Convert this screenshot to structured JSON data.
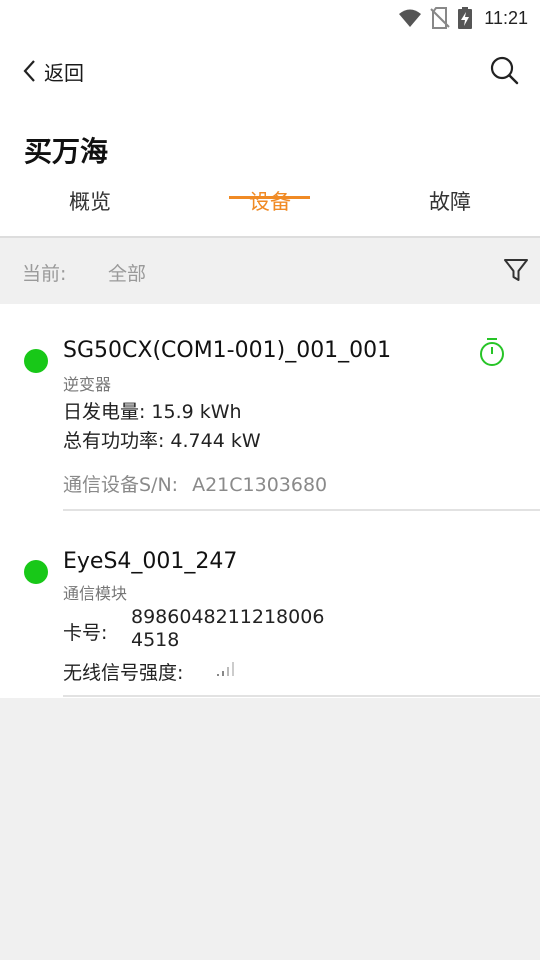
{
  "status_bar": {
    "time": "11:21"
  },
  "header": {
    "back_label": "返回",
    "title": "买万海"
  },
  "tabs": [
    {
      "label": "概览"
    },
    {
      "label": "设备"
    },
    {
      "label": "故障"
    }
  ],
  "filter": {
    "label": "当前:",
    "value": "全部"
  },
  "devices": [
    {
      "name": "SG50CX(COM1-001)_001_001",
      "type": "逆变器",
      "status_color": "#18c818",
      "daily_energy_label": "日发电量:",
      "daily_energy_value": "15.9 kWh",
      "active_power_label": "总有功功率:",
      "active_power_value": "4.744 kW",
      "comm_sn_label": "通信设备S/N:",
      "comm_sn_value": "A21C1303680"
    },
    {
      "name": "EyeS4_001_247",
      "type": "通信模块",
      "status_color": "#18c818",
      "card_label": "卡号:",
      "card_line1": "8986048211218006",
      "card_line2": "4518",
      "signal_label": "无线信号强度:"
    }
  ],
  "colors": {
    "accent": "#f08a24",
    "online": "#18c818"
  }
}
